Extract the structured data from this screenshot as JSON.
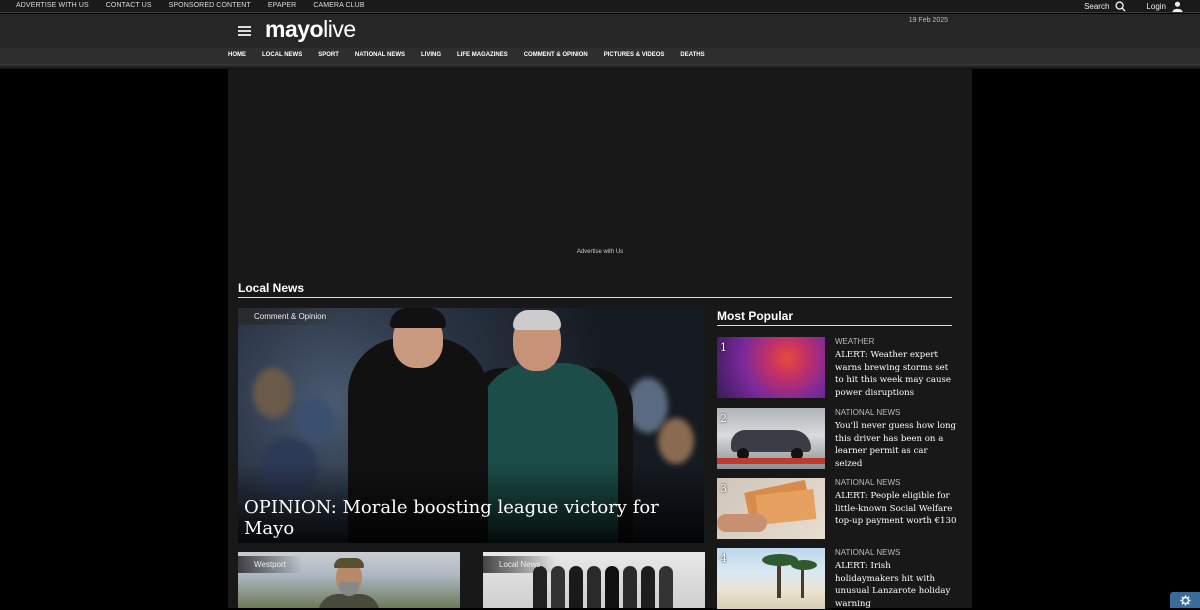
{
  "topbar": {
    "links": [
      "ADVERTISE WITH US",
      "CONTACT US",
      "SPONSORED CONTENT",
      "EPAPER",
      "CAMERA CLUB"
    ],
    "search_label": "Search",
    "login_label": "Login"
  },
  "header": {
    "logo_bold": "mayo",
    "logo_light": "live",
    "date": "19 Feb 2025"
  },
  "nav": {
    "items": [
      "HOME",
      "LOCAL NEWS",
      "SPORT",
      "NATIONAL NEWS",
      "LIVING",
      "LIFE MAGAZINES",
      "COMMENT & OPINION",
      "PICTURES & VIDEOS",
      "DEATHS"
    ]
  },
  "ad": {
    "label": "Advertise with Us"
  },
  "local_news": {
    "title": "Local News",
    "hero": {
      "tag": "Comment & Opinion",
      "headline": "OPINION: Morale boosting league victory for Mayo"
    },
    "cards": [
      {
        "tag": "Westport"
      },
      {
        "tag": "Local News"
      }
    ]
  },
  "most_popular": {
    "title": "Most Popular",
    "items": [
      {
        "num": "1",
        "category": "WEATHER",
        "headline": "ALERT: Weather expert warns brewing storms set to hit this week may cause power disruptions"
      },
      {
        "num": "2",
        "category": "NATIONAL NEWS",
        "headline": "You'll never guess how long this driver has been on a learner permit as car seized"
      },
      {
        "num": "3",
        "category": "NATIONAL NEWS",
        "headline": "ALERT: People eligible for little-known Social Welfare top-up payment worth €130"
      },
      {
        "num": "4",
        "category": "NATIONAL NEWS",
        "headline": "ALERT: Irish holidaymakers hit with unusual Lanzarote holiday warning"
      }
    ]
  },
  "icons": {
    "search": "search-icon",
    "user": "user-icon",
    "menu": "hamburger-menu-icon",
    "settings": "settings-gear-icon"
  }
}
